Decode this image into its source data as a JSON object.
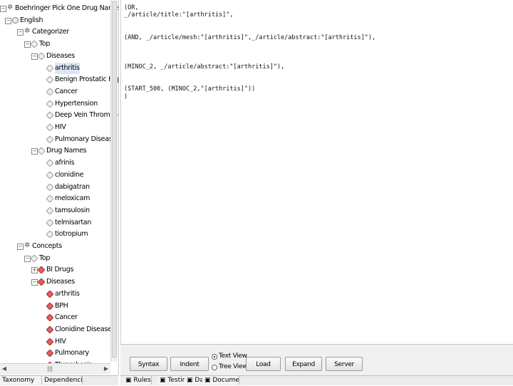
{
  "tree": [
    {
      "label": "Boehringer Pick One Drug Names Disease",
      "level": 0,
      "icon": "star",
      "expand": "minus"
    },
    {
      "label": "English",
      "level": 1,
      "icon": "globe",
      "expand": "minus"
    },
    {
      "label": "Categorizer",
      "level": 2,
      "icon": "star",
      "expand": "minus"
    },
    {
      "label": "Top",
      "level": 3,
      "icon": "hex",
      "expand": "minus"
    },
    {
      "label": "Diseases",
      "level": 4,
      "icon": "hex",
      "expand": "minus"
    },
    {
      "label": "arthritis",
      "level": 5,
      "icon": "hex",
      "selected": true
    },
    {
      "label": "Benign Prostatic Hyperpla",
      "level": 5,
      "icon": "hex"
    },
    {
      "label": "Cancer",
      "level": 5,
      "icon": "hex"
    },
    {
      "label": "Hypertension",
      "level": 5,
      "icon": "hex"
    },
    {
      "label": "Deep Vein Thrombosis",
      "level": 5,
      "icon": "hex"
    },
    {
      "label": "HIV",
      "level": 5,
      "icon": "hex"
    },
    {
      "label": "Pulmonary Disease",
      "level": 5,
      "icon": "hex"
    },
    {
      "label": "Drug Names",
      "level": 4,
      "icon": "hex",
      "expand": "minus"
    },
    {
      "label": "afrinis",
      "level": 5,
      "icon": "hex"
    },
    {
      "label": "clonidine",
      "level": 5,
      "icon": "hex"
    },
    {
      "label": "dabigatran",
      "level": 5,
      "icon": "hex"
    },
    {
      "label": "meloxicam",
      "level": 5,
      "icon": "hex"
    },
    {
      "label": "tamsulosin",
      "level": 5,
      "icon": "hex"
    },
    {
      "label": "telmisartan",
      "level": 5,
      "icon": "hex"
    },
    {
      "label": "tiotropium",
      "level": 5,
      "icon": "hex"
    },
    {
      "label": "Concepts",
      "level": 2,
      "icon": "star",
      "expand": "minus"
    },
    {
      "label": "Top",
      "level": 3,
      "icon": "hex",
      "expand": "minus"
    },
    {
      "label": "BI Drugs",
      "level": 4,
      "icon": "red",
      "expand": "plus"
    },
    {
      "label": "Diseases",
      "level": 4,
      "icon": "red",
      "expand": "minus"
    },
    {
      "label": "arthritis",
      "level": 5,
      "icon": "red"
    },
    {
      "label": "BPH",
      "level": 5,
      "icon": "red"
    },
    {
      "label": "Cancer",
      "level": 5,
      "icon": "red"
    },
    {
      "label": "Clonidine Disease",
      "level": 5,
      "icon": "red"
    },
    {
      "label": "HIV",
      "level": 5,
      "icon": "red"
    },
    {
      "label": "Pulmonary",
      "level": 5,
      "icon": "red"
    },
    {
      "label": "Thrombosis",
      "level": 5,
      "icon": "red"
    }
  ],
  "left_tabs": [
    "Taxonomy",
    "Dependencies"
  ],
  "editor_lines": [
    "(OR,",
    "_/article/title:\"[arthritis]\",",
    "",
    "",
    "(AND, _/article/mesh:\"[arthritis]\",_/article/abstract:\"[arthritis]\"),",
    "",
    "",
    "",
    "(MINOC_2, _/article/abstract:\"[arthritis]\"),",
    "",
    "",
    "(START_500, (MINOC_2,\"[arthritis]\"))",
    ")"
  ],
  "toolbar": {
    "syntax_check": "Syntax Check",
    "indent": "Indent",
    "text_view": "Text View",
    "tree_view": "Tree View",
    "load_text": "Load Text...",
    "expand_forms": "Expand Forms",
    "server_query": "Server Query..."
  },
  "right_tabs": [
    "Rules",
    "Testing",
    "Data",
    "Document"
  ],
  "icons": {
    "expand": "tree-expander-icon",
    "node": "category-node-icon",
    "concept": "concept-node-icon"
  }
}
